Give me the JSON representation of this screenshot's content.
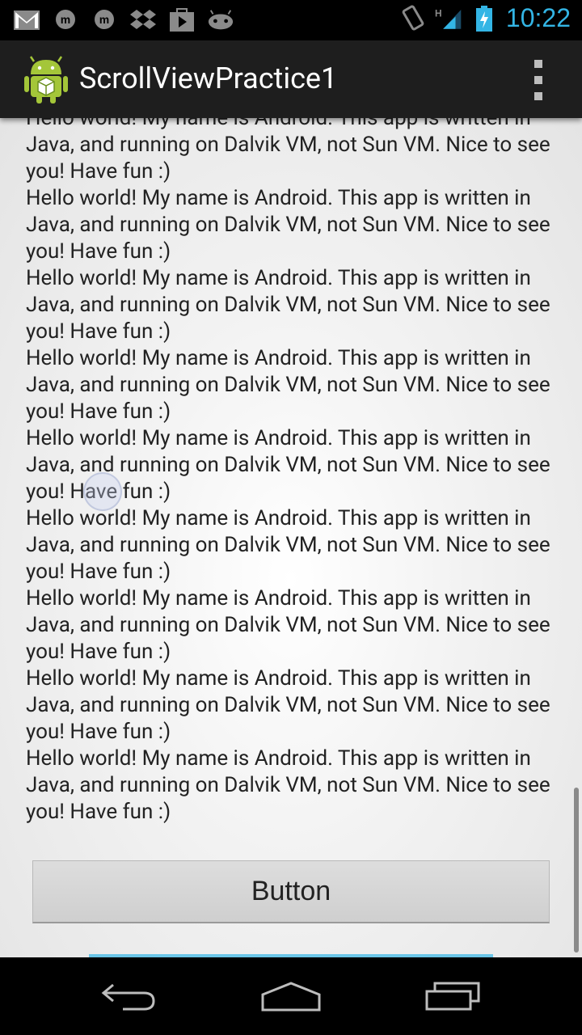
{
  "status_bar": {
    "time": "10:22",
    "network_type": "H",
    "icons": [
      "gmail-icon",
      "messenger-icon",
      "messenger-icon",
      "dropbox-icon",
      "play-store-icon",
      "android-game-icon",
      "vibrate-icon",
      "signal-icon",
      "battery-charging-icon"
    ]
  },
  "action_bar": {
    "title": "ScrollViewPractice1",
    "overflow_menu_icon": "overflow-menu-icon"
  },
  "content": {
    "paragraph_text": "Hello world! My name is Android. This app is written in Java, and running on Dalvik VM, not Sun VM. Nice to see you! Have fun :)",
    "paragraphs": [
      "Hello world! My name is Android. This app is written in Java, and running on Dalvik VM, not Sun VM. Nice to see you! Have fun :)",
      "Hello world! My name is Android. This app is written in Java, and running on Dalvik VM, not Sun VM. Nice to see you! Have fun :)",
      "Hello world! My name is Android. This app is written in Java, and running on Dalvik VM, not Sun VM. Nice to see you! Have fun :)",
      "Hello world! My name is Android. This app is written in Java, and running on Dalvik VM, not Sun VM. Nice to see you! Have fun :)",
      "Hello world! My name is Android. This app is written in Java, and running on Dalvik VM, not Sun VM. Nice to see you! Have fun :)",
      "Hello world! My name is Android. This app is written in Java, and running on Dalvik VM, not Sun VM. Nice to see you! Have fun :)",
      "Hello world! My name is Android. This app is written in Java, and running on Dalvik VM, not Sun VM. Nice to see you! Have fun :)",
      "Hello world! My name is Android. This app is written in Java, and running on Dalvik VM, not Sun VM. Nice to see you! Have fun :)",
      "Hello world! My name is Android. This app is written in Java, and running on Dalvik VM, not Sun VM. Nice to see you! Have fun :)"
    ],
    "button_label": "Button"
  },
  "nav_bar": {
    "icons": [
      "back-icon",
      "home-icon",
      "recent-apps-icon"
    ]
  },
  "colors": {
    "accent": "#33b5e5",
    "action_bar_bg": "#1e1e1e",
    "status_bar_bg": "#000000"
  }
}
